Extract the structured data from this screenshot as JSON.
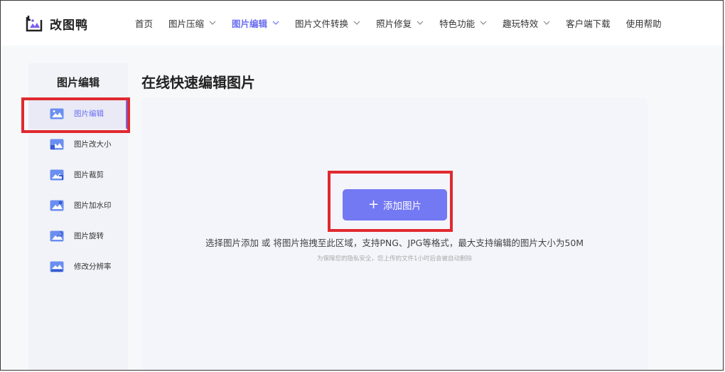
{
  "header": {
    "logo_text": "改图鸭",
    "nav": [
      {
        "label": "首页",
        "has_dropdown": false,
        "active": false
      },
      {
        "label": "图片压缩",
        "has_dropdown": true,
        "active": false
      },
      {
        "label": "图片编辑",
        "has_dropdown": true,
        "active": true
      },
      {
        "label": "图片文件转换",
        "has_dropdown": true,
        "active": false
      },
      {
        "label": "照片修复",
        "has_dropdown": true,
        "active": false
      },
      {
        "label": "特色功能",
        "has_dropdown": true,
        "active": false
      },
      {
        "label": "趣玩特效",
        "has_dropdown": true,
        "active": false
      },
      {
        "label": "客户端下载",
        "has_dropdown": false,
        "active": false
      },
      {
        "label": "使用帮助",
        "has_dropdown": false,
        "active": false
      }
    ]
  },
  "sidebar": {
    "title": "图片编辑",
    "items": [
      {
        "label": "图片编辑",
        "icon": "image-edit-icon",
        "active": true
      },
      {
        "label": "图片改大小",
        "icon": "image-resize-icon",
        "active": false
      },
      {
        "label": "图片裁剪",
        "icon": "image-crop-icon",
        "active": false
      },
      {
        "label": "图片加水印",
        "icon": "image-watermark-icon",
        "active": false
      },
      {
        "label": "图片旋转",
        "icon": "image-rotate-icon",
        "active": false
      },
      {
        "label": "修改分辨率",
        "icon": "image-resolution-icon",
        "active": false
      }
    ]
  },
  "main": {
    "title": "在线快速编辑图片",
    "add_button_label": "添加图片",
    "hint": "选择图片添加 或 将图片拖拽至此区域，支持PNG、JPG等格式，最大支持编辑的图片大小为50M",
    "privacy_note": "为保障您的隐私安全，您上传的文件1小时后会被自动删除"
  },
  "colors": {
    "accent": "#6b6ff0",
    "button": "#7378f3",
    "annotation_red": "#e0292f"
  }
}
